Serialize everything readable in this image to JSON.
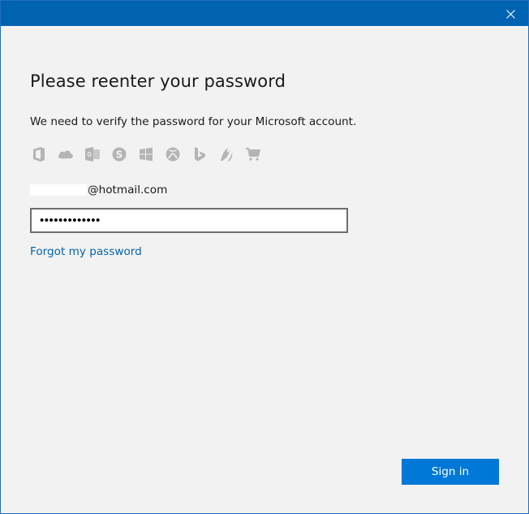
{
  "window": {
    "close_icon": "close-icon"
  },
  "dialog": {
    "title": "Please reenter your password",
    "description": "We need to verify the password for your Microsoft account.",
    "service_icons": [
      "office-icon",
      "onedrive-icon",
      "outlook-icon",
      "skype-icon",
      "windows-icon",
      "xbox-icon",
      "bing-icon",
      "msn-icon",
      "store-icon"
    ],
    "email_suffix": "@hotmail.com",
    "password_value": "•••••••••••••",
    "forgot_password_label": "Forgot my password",
    "sign_in_label": "Sign in"
  },
  "colors": {
    "titlebar": "#0063b1",
    "background": "#f2f2f2",
    "accent": "#0078d7",
    "link": "#0063b1",
    "icon_gray": "#b4b4b4"
  }
}
